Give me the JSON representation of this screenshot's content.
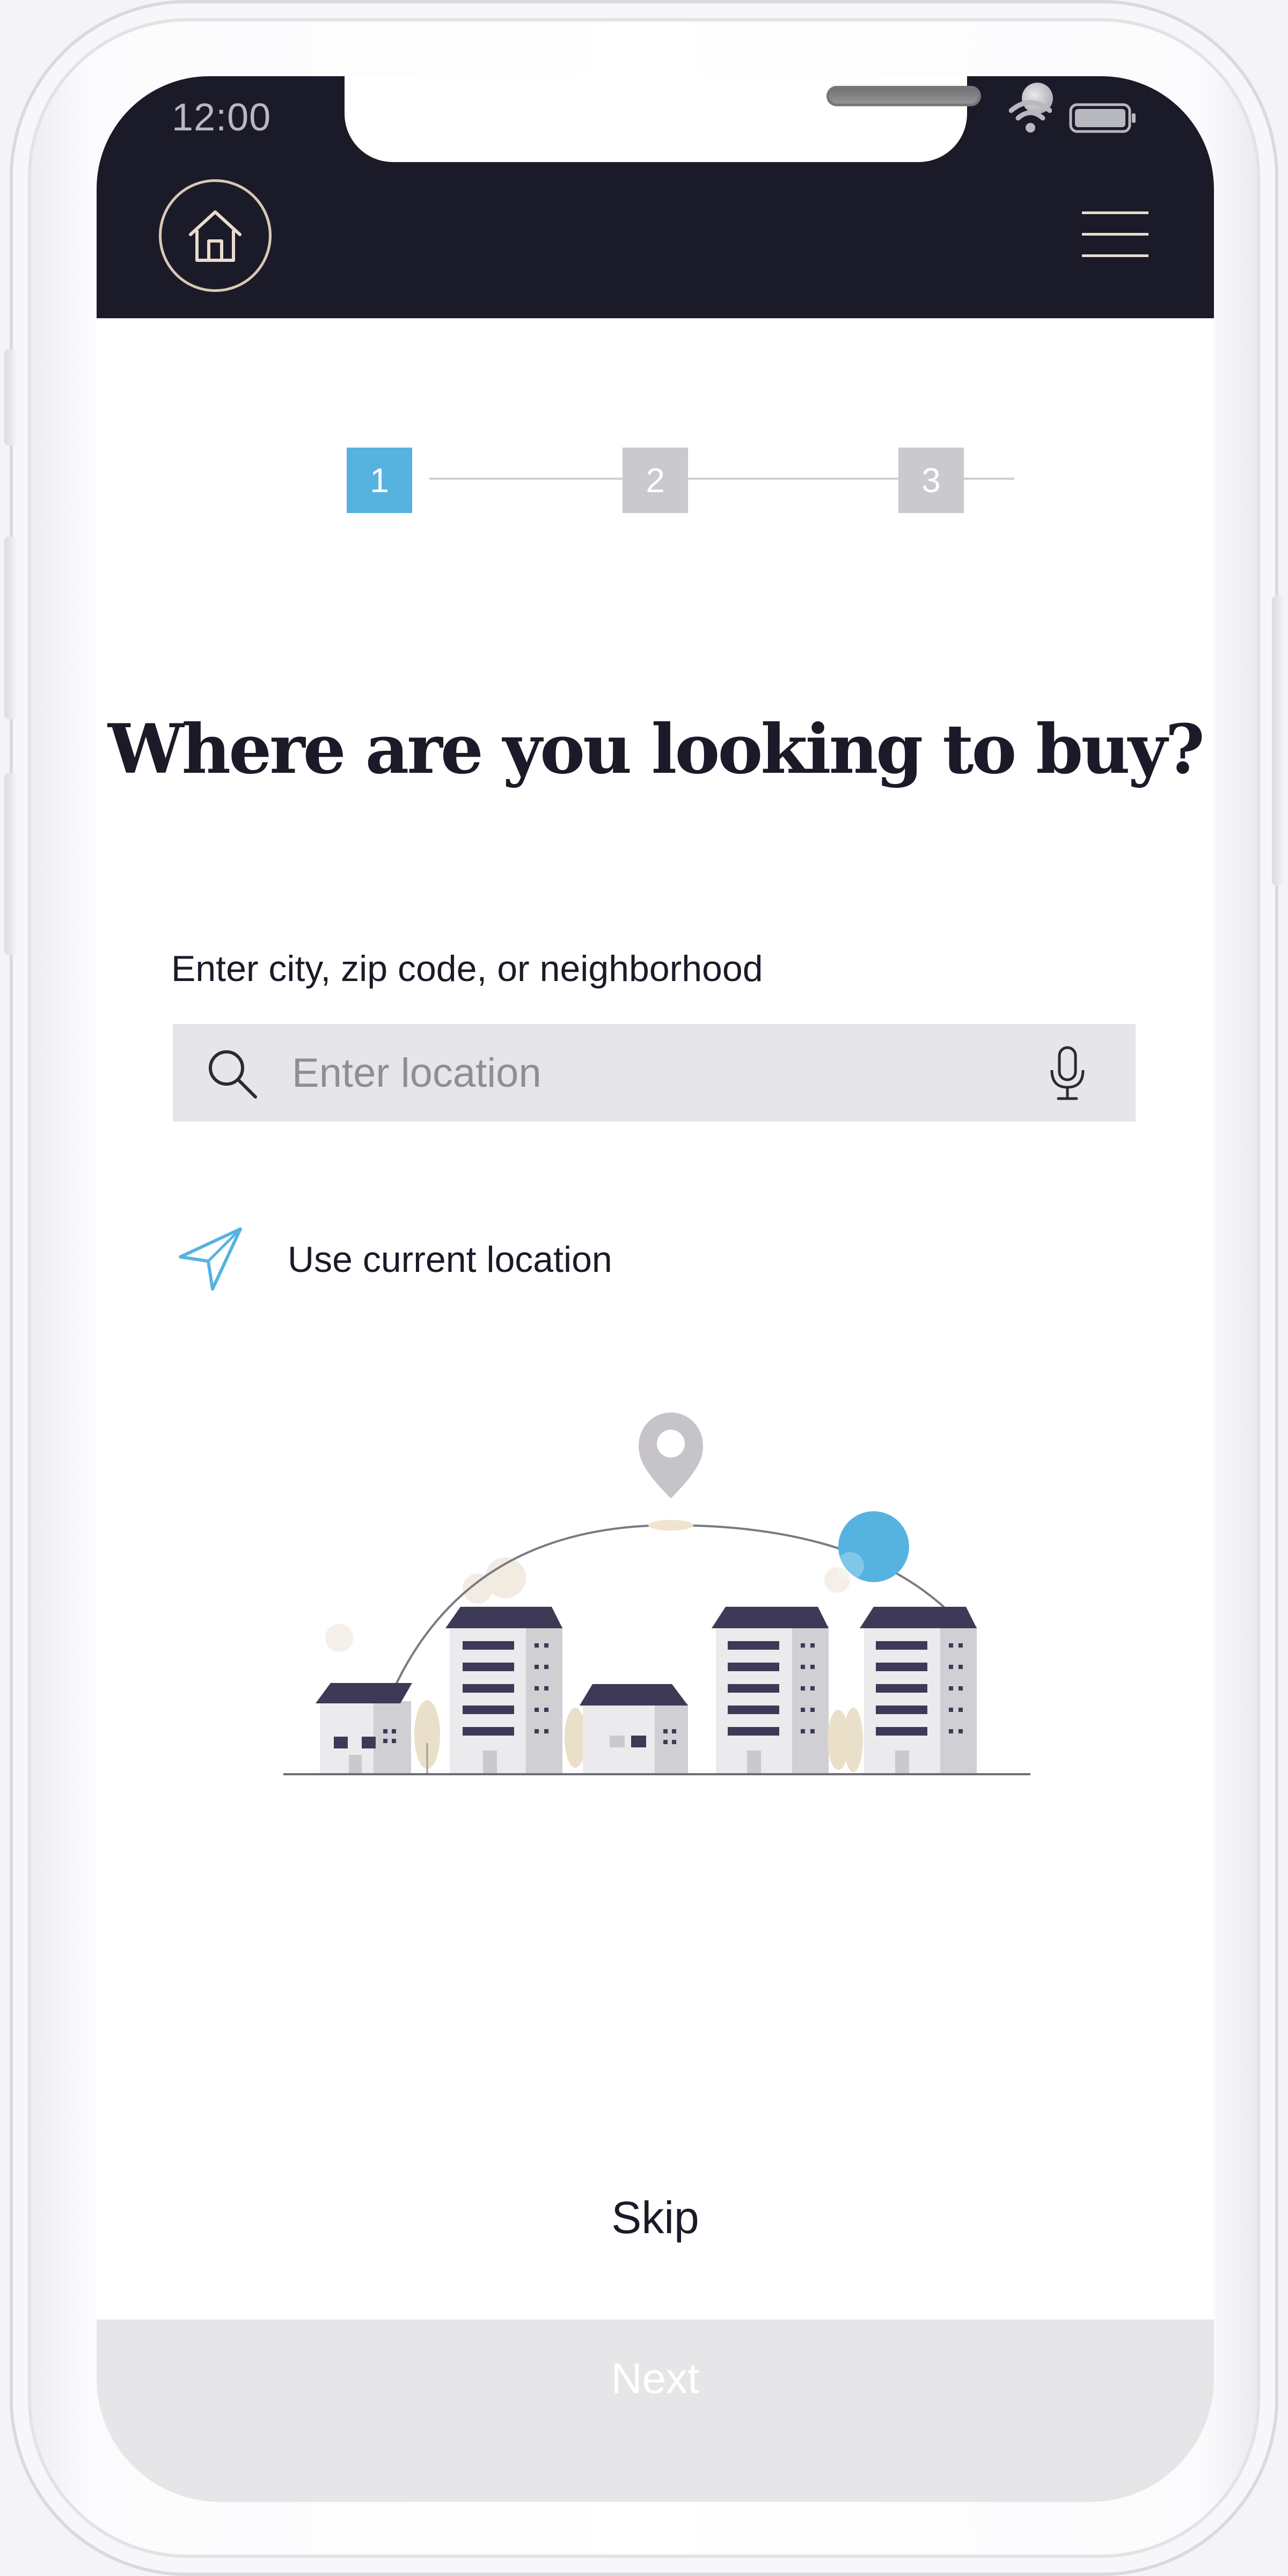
{
  "status_bar": {
    "time": "12:00"
  },
  "header": {
    "logo_icon": "house-icon",
    "menu_icon": "hamburger-menu-icon"
  },
  "stepper": {
    "steps": [
      "1",
      "2",
      "3"
    ],
    "current_step": 1
  },
  "main": {
    "title": "Where are you looking to buy?",
    "field_label": "Enter city, zip code, or neighborhood",
    "search": {
      "placeholder": "Enter location",
      "value": "",
      "icon": "search-icon",
      "voice_icon": "microphone-icon"
    },
    "use_location": {
      "label": "Use current location",
      "icon": "location-arrow-icon"
    },
    "illustration": "city-buildings-map-pin-illustration"
  },
  "footer": {
    "skip_label": "Skip",
    "next_label": "Next"
  },
  "colors": {
    "header_bg": "#1b1a28",
    "accent": "#56b3e0",
    "step_inactive": "#c9c9ce",
    "input_bg": "#e6e6e9",
    "logo_ring": "#d8c8b4"
  }
}
